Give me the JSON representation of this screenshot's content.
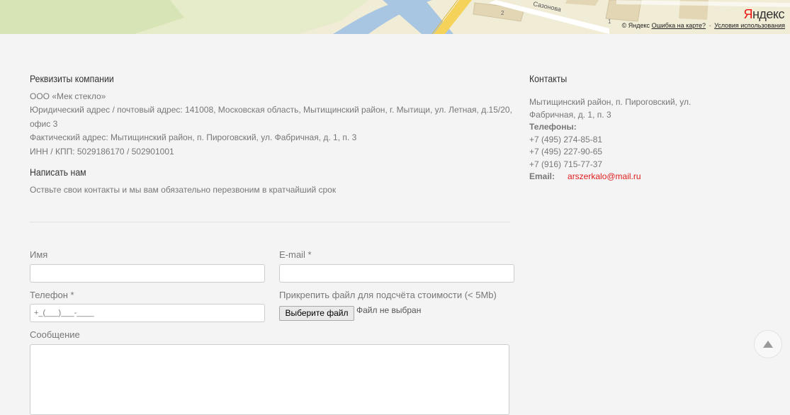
{
  "map": {
    "logo_first": "Я",
    "logo_rest": "ндекс",
    "street": "Сазонова",
    "house_1": "2",
    "house_2": "1",
    "copyright": "© Яндекс",
    "error_link": "Ошибка на карте?",
    "separator": "·",
    "terms_link": "Условия использования"
  },
  "requisites": {
    "title": "Реквизиты компании",
    "lines": [
      "ООО «Мек стекло»",
      "Юридический адрес / почтовый адрес: 141008, Московская область, Мытищинский район, г. Мытищи, ул. Летная, д.15/20,",
      "офис 3",
      "Фактический адрес: Мытищинский район, п. Пироговский, ул. Фабричная, д. 1, п. 3",
      "ИНН / КПП: 5029186170 / 502901001"
    ]
  },
  "write_us": {
    "title": "Написать нам",
    "subtitle": "Оствьте свои контакты и мы вам обязательно перезвоним в кратчайший срок"
  },
  "contacts": {
    "title": "Контакты",
    "address_line1": "Мытищинский район, п. Пироговский, ул.",
    "address_line2": "Фабричная, д. 1, п. 3",
    "phones_label": "Телефоны:",
    "phones": [
      "+7 (495) 274-85-81",
      "+7 (495) 227-90-65",
      "+7 (916) 715-77-37"
    ],
    "email_label": "Email:",
    "email": "arszerkalo@mail.ru",
    "link_color": "#e01b1b"
  },
  "form": {
    "name_label": "Имя",
    "name_value": "",
    "email_label": "E-mail *",
    "email_value": "",
    "phone_label": "Телефон *",
    "phone_value": "+_(___)___-____",
    "file_label": "Прикрепить файл для подсчёта стоимости (< 5Mb)",
    "file_button": "Выберите файл",
    "file_status": "Файл не выбран",
    "message_label": "Сообщение",
    "message_value": ""
  },
  "scroll_top": {
    "icon": "arrow-up-icon"
  }
}
